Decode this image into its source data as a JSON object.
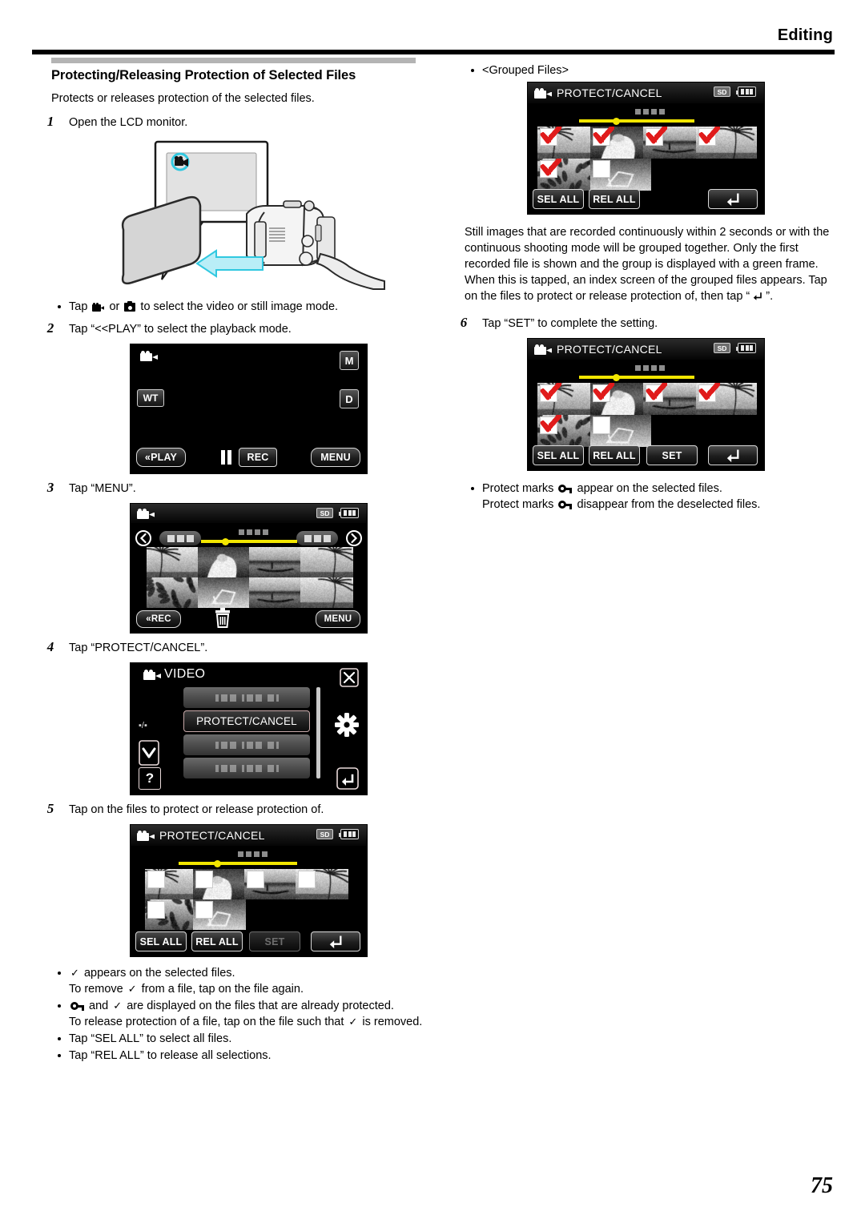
{
  "header": {
    "title": "Editing"
  },
  "page": {
    "number": "75"
  },
  "section": {
    "title": "Protecting/Releasing Protection of Selected Files",
    "lead": "Protects or releases protection of the selected files."
  },
  "steps": [
    {
      "num": "1",
      "text": "Open the LCD monitor."
    },
    {
      "num": "2",
      "text": "Tap “<<PLAY” to select the playback mode."
    },
    {
      "num": "3",
      "text": "Tap “MENU”."
    },
    {
      "num": "4",
      "text": "Tap “PROTECT/CANCEL”."
    },
    {
      "num": "5",
      "text": "Tap on the files to protect or release protection of."
    },
    {
      "num": "6",
      "text": "Tap “SET” to complete the setting."
    }
  ],
  "notes": {
    "mode_select_pre": "Tap",
    "mode_select_mid": "or",
    "mode_select_post": "to select the video or still image mode.",
    "grouped_files_label": "<Grouped Files>",
    "grouped_paragraph": "Still images that are recorded continuously within 2 seconds or with the continuous shooting mode will be grouped together. Only the first recorded file is shown and the group is displayed with a green frame. When this is tapped, an index screen of the grouped files appears. Tap on the files to protect or release protection of, then tap “",
    "grouped_paragraph_end": "”.",
    "check_appears_a": "appears on the selected files.",
    "check_appears_b_pre": "To remove",
    "check_appears_b_post": "from a file, tap on the file again.",
    "lock_and_check_pre": "and",
    "lock_and_check_post": "are displayed on the files that are already protected.",
    "release_protection_pre": "To release protection of a file, tap on the file such that",
    "release_protection_post": "is removed.",
    "sel_all_note": "Tap “SEL ALL” to select all files.",
    "rel_all_note": "Tap “REL ALL” to release all selections.",
    "protect_marks_pre": "Protect marks",
    "protect_marks_appear": "appear on the selected files.",
    "protect_marks_pre2": "Protect marks",
    "protect_marks_disappear": "disappear from the deselected files."
  },
  "screens": {
    "record_mode": {
      "name": "record-standby-screen",
      "indicators": {
        "wt": "WT",
        "m": "M",
        "d": "D"
      },
      "buttons": {
        "play": "«PLAY",
        "rec": "REC",
        "menu": "MENU"
      }
    },
    "index": {
      "name": "index-screen",
      "badges": {
        "sd": "SD"
      },
      "buttons": {
        "rec": "«REC",
        "menu": "MENU"
      }
    },
    "menu": {
      "name": "video-menu-screen",
      "title": "VIDEO",
      "page_indicator": "▪/▪",
      "help": "?",
      "rows": [
        "",
        "PROTECT/CANCEL",
        "",
        ""
      ],
      "selected_row": "PROTECT/CANCEL"
    },
    "protect_empty": {
      "name": "protect-cancel-screen",
      "title": "PROTECT/CANCEL",
      "badges": {
        "sd": "SD"
      },
      "buttons": {
        "sel_all": "SEL ALL",
        "rel_all": "REL ALL",
        "set": "SET"
      },
      "set_enabled": false,
      "checks": [
        false,
        false,
        false,
        false,
        false,
        false
      ]
    },
    "protect_grouped": {
      "name": "protect-cancel-grouped-screen",
      "title": "PROTECT/CANCEL",
      "badges": {
        "sd": "SD"
      },
      "buttons": {
        "sel_all": "SEL ALL",
        "rel_all": "REL ALL"
      },
      "checks": [
        true,
        true,
        true,
        true,
        true,
        false
      ]
    },
    "protect_set": {
      "name": "protect-cancel-set-screen",
      "title": "PROTECT/CANCEL",
      "badges": {
        "sd": "SD"
      },
      "buttons": {
        "sel_all": "SEL ALL",
        "rel_all": "REL ALL",
        "set": "SET"
      },
      "set_enabled": true,
      "checks": [
        true,
        true,
        true,
        true,
        true,
        false
      ]
    }
  },
  "colors": {
    "accent_yellow": "#f2e600",
    "check_red": "#e01b1b",
    "rule_black": "#000000",
    "section_bar_gray": "#b4b4b4",
    "highlight_cyan": "#30c8e0"
  }
}
